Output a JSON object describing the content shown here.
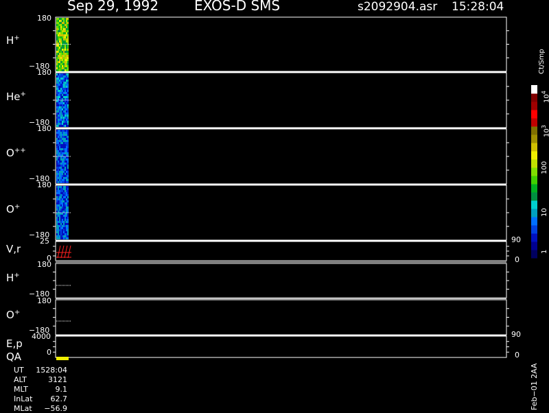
{
  "header": {
    "date": "Sep 29, 1992",
    "instrument": "EXOS-D SMS",
    "file": "s2092904.asr",
    "time": "15:28:04"
  },
  "panels": [
    {
      "ion": "H",
      "charge": "+",
      "y_top": "180",
      "y_bot": "−180"
    },
    {
      "ion": "He",
      "charge": "+",
      "y_top": "180",
      "y_bot": "−180"
    },
    {
      "ion": "O",
      "charge": "++",
      "y_top": "180",
      "y_bot": "−180"
    },
    {
      "ion": "O",
      "charge": "+",
      "y_top": "180",
      "y_bot": "−180"
    },
    {
      "ion": "V,r",
      "charge": "",
      "y_top": "25",
      "y_bot": "0",
      "right_top": "90",
      "right_bot": "0"
    },
    {
      "ion": "H",
      "charge": "+",
      "y_top": "180",
      "y_bot": "−180"
    },
    {
      "ion": "O",
      "charge": "+",
      "y_top": "180",
      "y_bot": "−180"
    },
    {
      "ion": "E,p",
      "charge": "",
      "y_top": "4000",
      "y_bot": "0",
      "right_top": "90",
      "right_bot": "0"
    }
  ],
  "qa_label": "QA",
  "colorbar": {
    "unit": "Ct/Smp",
    "ticks": [
      "1",
      "10",
      "100",
      "10",
      "10"
    ],
    "tick_exponents": [
      "",
      "",
      "",
      "3",
      "4"
    ],
    "colors": [
      "#000060",
      "#000090",
      "#0010c0",
      "#0040e0",
      "#0070ff",
      "#00a0c0",
      "#00d0d0",
      "#009040",
      "#00b020",
      "#40d000",
      "#80e000",
      "#c0e000",
      "#f0f000",
      "#d0c000",
      "#a09000",
      "#807000",
      "#c00000",
      "#ff0000",
      "#a00000",
      "#800000",
      "#ffffff"
    ]
  },
  "info": [
    {
      "key": "UT",
      "value": "1528:04"
    },
    {
      "key": "ALT",
      "value": "3121"
    },
    {
      "key": "MLT",
      "value": "9.1"
    },
    {
      "key": "InLat",
      "value": "62.7"
    },
    {
      "key": "MLat",
      "value": "−56.9"
    }
  ],
  "footer_note": "Feb−01 2AA"
}
